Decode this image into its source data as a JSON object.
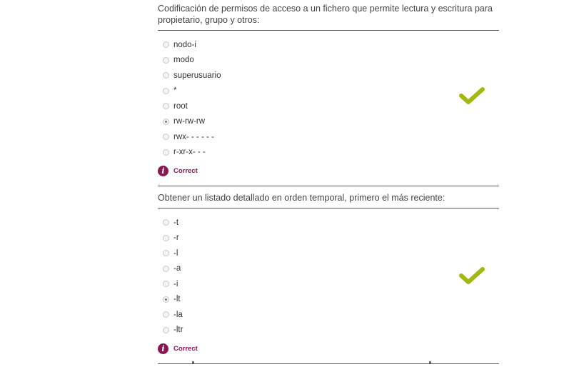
{
  "questions": [
    {
      "text": "Codificación de permisos de acceso a un fichero que permite lectura y escritura para propietario, grupo y otros:",
      "options": [
        "nodo-i",
        "modo",
        "superusuario",
        "*",
        "root",
        "rw-rw-rw",
        "rwx- - - - - -",
        "r-xr-x- - -"
      ],
      "selected": "rw-rw-rw",
      "feedback": "Correct",
      "result_icon": "checkmark-icon",
      "feedback_icon": "info-icon"
    },
    {
      "text": "Obtener un listado detallado en orden temporal, primero el más reciente:",
      "options": [
        "-t",
        "-r",
        "-l",
        "-a",
        "-i",
        "-lt",
        "-la",
        "-ltr"
      ],
      "selected": "-lt",
      "feedback": "Correct",
      "result_icon": "checkmark-icon",
      "feedback_icon": "info-icon"
    }
  ],
  "colors": {
    "correct_check": "#a3b811",
    "feedback_accent": "#8a1656",
    "separator": "#555555"
  }
}
